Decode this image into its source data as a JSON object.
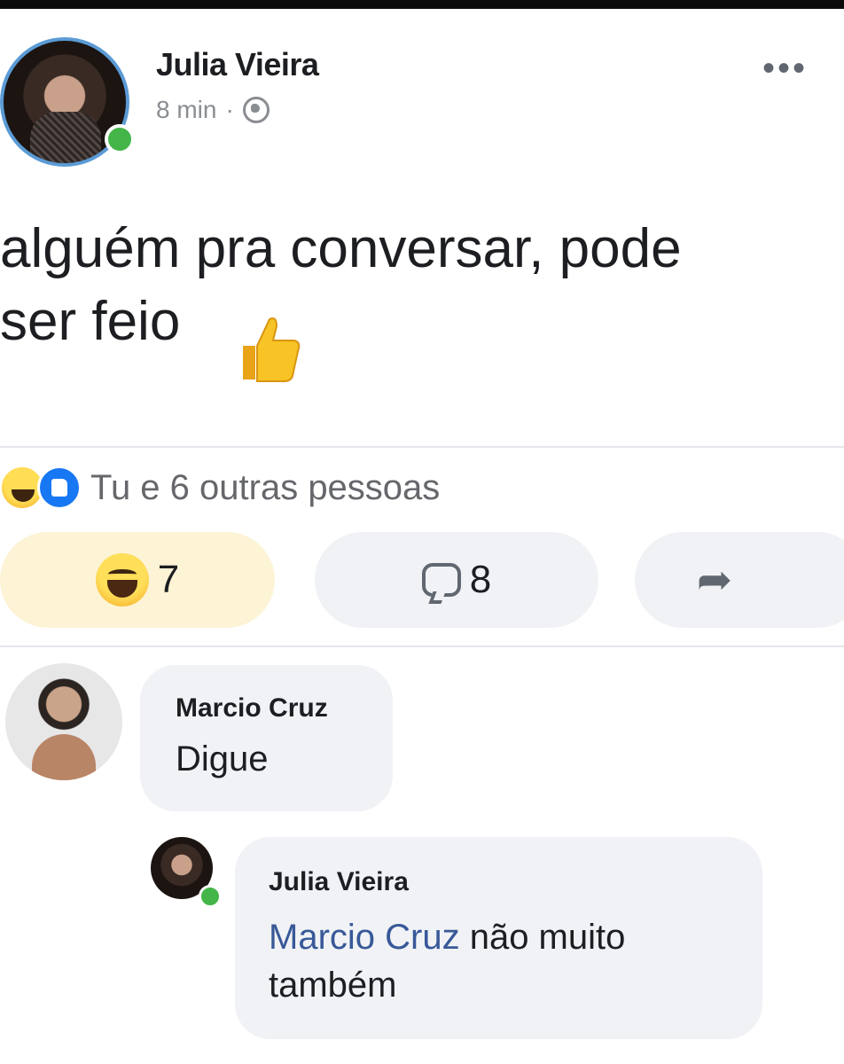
{
  "post": {
    "author": "Julia Vieira",
    "time": "8 min",
    "separator": "·",
    "text": "alguém pra conversar, pode\nser feio",
    "emoji": "thumbs-up"
  },
  "reactions": {
    "summary": "Tu e 6 outras pessoas",
    "react_count": "7",
    "comment_count": "8"
  },
  "comments": [
    {
      "author": "Marcio Cruz",
      "text": "Digue"
    },
    {
      "author": "Julia Vieira",
      "mention": "Marcio Cruz",
      "text": " não muito também"
    }
  ],
  "colors": {
    "online": "#44b549",
    "mention": "#385898",
    "bubble": "#f0f2f5",
    "avatar_ring": "#5b9bd5"
  }
}
